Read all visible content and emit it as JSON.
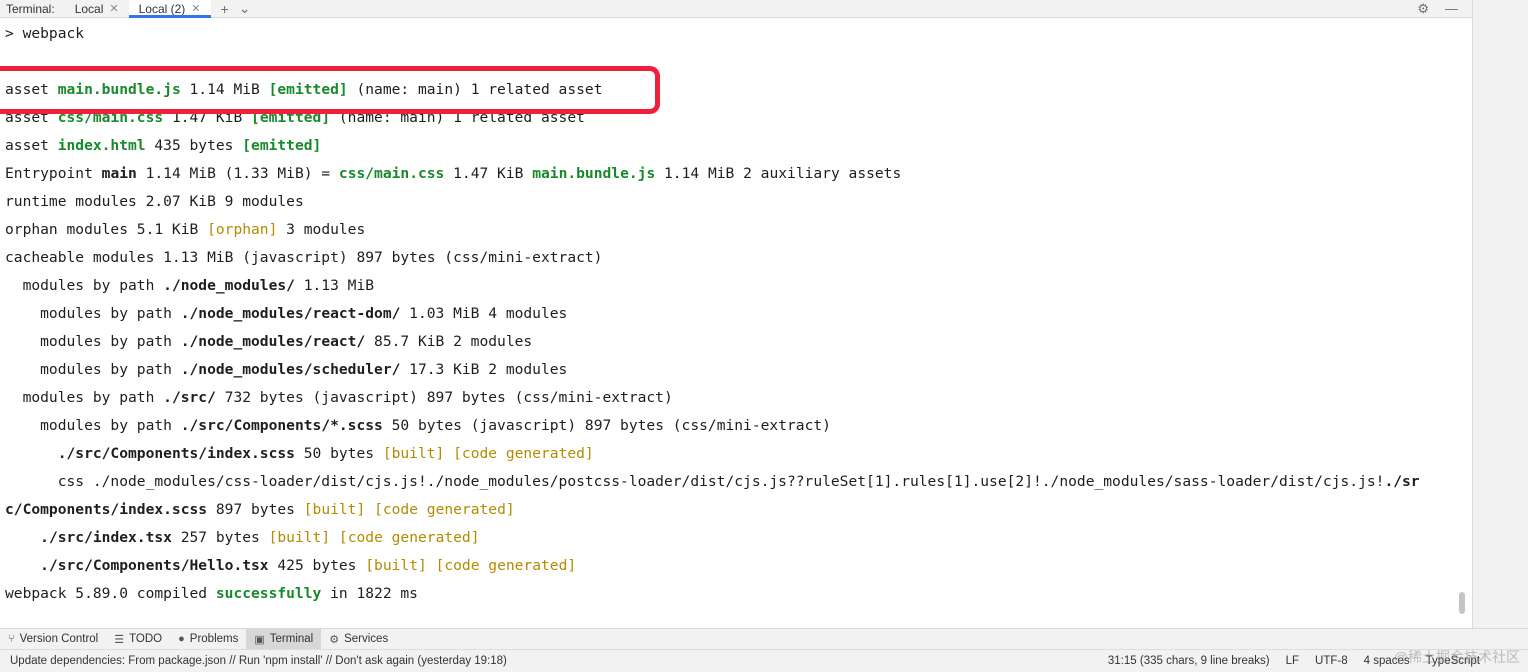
{
  "tabbar": {
    "title": "Terminal:",
    "tabs": [
      {
        "label": "Local"
      },
      {
        "label": "Local (2)"
      }
    ]
  },
  "terminal": {
    "prompt": "> webpack",
    "l1": {
      "a": "asset ",
      "b": "main.bundle.js",
      "c": " 1.14 MiB ",
      "d": "[emitted]",
      "e": " (name: main) 1 related asset"
    },
    "l2": {
      "a": "asset ",
      "b": "css/main.css",
      "c": " 1.47 KiB ",
      "d": "[emitted]",
      "e": " (name: main) 1 related asset"
    },
    "l3": {
      "a": "asset ",
      "b": "index.html",
      "c": " 435 bytes ",
      "d": "[emitted]"
    },
    "l4": {
      "a": "Entrypoint ",
      "b": "main",
      "c": " 1.14 MiB (1.33 MiB) = ",
      "d": "css/main.css",
      "e": " 1.47 KiB ",
      "f": "main.bundle.js",
      "g": " 1.14 MiB 2 auxiliary assets"
    },
    "l5": "runtime modules 2.07 KiB 9 modules",
    "l6": {
      "a": "orphan modules 5.1 KiB ",
      "b": "[orphan]",
      "c": " 3 modules"
    },
    "l7": "cacheable modules 1.13 MiB (javascript) 897 bytes (css/mini-extract)",
    "l8": {
      "a": "  modules by path ",
      "b": "./node_modules/",
      "c": " 1.13 MiB"
    },
    "l9": {
      "a": "    modules by path ",
      "b": "./node_modules/react-dom/",
      "c": " 1.03 MiB 4 modules"
    },
    "l10": {
      "a": "    modules by path ",
      "b": "./node_modules/react/",
      "c": " 85.7 KiB 2 modules"
    },
    "l11": {
      "a": "    modules by path ",
      "b": "./node_modules/scheduler/",
      "c": " 17.3 KiB 2 modules"
    },
    "l12": {
      "a": "  modules by path ",
      "b": "./src/",
      "c": " 732 bytes (javascript) 897 bytes (css/mini-extract)"
    },
    "l13": {
      "a": "    modules by path ",
      "b": "./src/Components/*.scss",
      "c": " 50 bytes (javascript) 897 bytes (css/mini-extract)"
    },
    "l14": {
      "a": "      ",
      "b": "./src/Components/index.scss",
      "c": " 50 bytes ",
      "d": "[built]",
      "e": " ",
      "f": "[code generated]"
    },
    "l15": {
      "a": "      css ./node_modules/css-loader/dist/cjs.js!./node_modules/postcss-loader/dist/cjs.js??ruleSet[1].rules[1].use[2]!./node_modules/sass-loader/dist/cjs.js!",
      "b": "./sr"
    },
    "l16": {
      "a": "c/Components/index.scss",
      "b": " 897 bytes ",
      "c": "[built]",
      "d": " ",
      "e": "[code generated]"
    },
    "l17": {
      "a": "    ",
      "b": "./src/index.tsx",
      "c": " 257 bytes ",
      "d": "[built]",
      "e": " ",
      "f": "[code generated]"
    },
    "l18": {
      "a": "    ",
      "b": "./src/Components/Hello.tsx",
      "c": " 425 bytes ",
      "d": "[built]",
      "e": " ",
      "f": "[code generated]"
    },
    "l19": {
      "a": "webpack 5.89.0 compiled ",
      "b": "successfully",
      "c": " in 1822 ms"
    }
  },
  "toolwindows": [
    {
      "label": "Version Control",
      "icon": "branch-icon"
    },
    {
      "label": "TODO",
      "icon": "list-icon"
    },
    {
      "label": "Problems",
      "icon": "warning-icon"
    },
    {
      "label": "Terminal",
      "icon": "terminal-icon"
    },
    {
      "label": "Services",
      "icon": "gear-icon"
    }
  ],
  "status": {
    "message": "Update dependencies: From package.json // Run 'npm install' // Don't ask again (yesterday 19:18)",
    "position": "31:15 (335 chars, 9 line breaks)",
    "line_sep": "LF",
    "encoding": "UTF-8",
    "indent": "4 spaces",
    "language": "TypeScript"
  },
  "watermark": "@稀土掘金技术社区",
  "colors": {
    "accent": "#3574f0",
    "success": "#178a2b",
    "warning": "#b58a00",
    "highlight": "#f0203c"
  }
}
